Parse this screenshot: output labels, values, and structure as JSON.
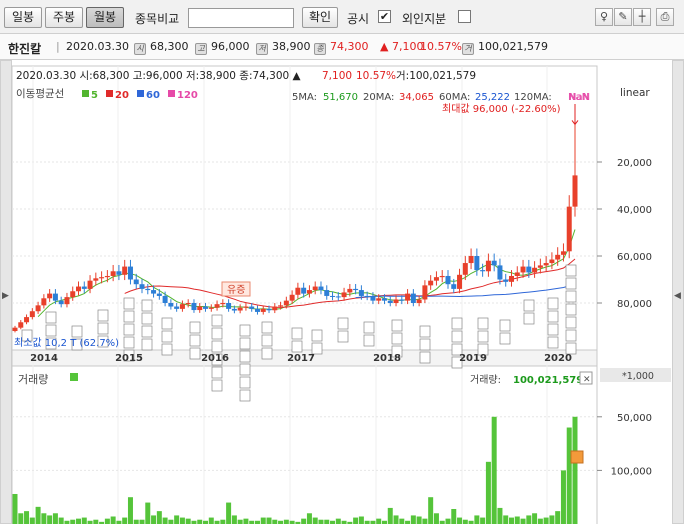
{
  "toolbar": {
    "daily": "일봉",
    "weekly": "주봉",
    "monthly": "월봉",
    "compare_label": "종목비교",
    "confirm": "확인",
    "disclosure_label": "공시",
    "foreign_label": "외인지분",
    "disclosure_checked": "✔",
    "icons": [
      "lamp-icon",
      "pen-icon",
      "crosshair-icon",
      "print-icon"
    ]
  },
  "info": {
    "name": "한진칼",
    "date": "2020.03.30",
    "open_icon": "시",
    "open": "68,300",
    "high_icon": "고",
    "high": "96,000",
    "low_icon": "저",
    "low": "38,900",
    "close_icon": "종",
    "close": "74,300",
    "change": "▲ 7,100",
    "change_pct": "10.57%",
    "volume_icon": "거",
    "volume": "100,021,579"
  },
  "price": {
    "header": "2020.03.30 시:68,300 고:96,000 저:38,900 종:74,300 ▲",
    "header_change": "7,100",
    "header_pct": "10.57%",
    "header_vol": "거:100,021,579",
    "ma_title": "이동평균선",
    "ma_legend": [
      {
        "label": "5",
        "color": "#52b52f"
      },
      {
        "label": "20",
        "color": "#e02a2a"
      },
      {
        "label": "60",
        "color": "#2f67d8"
      },
      {
        "label": "120",
        "color": "#e64aa8"
      }
    ],
    "ma_values": {
      "ma5_label": "5MA:",
      "ma5": "51,670",
      "ma20_label": "20MA:",
      "ma20": "34,065",
      "ma60_label": "60MA:",
      "ma60": "25,222",
      "ma120_label": "120MA:",
      "ma120": "NaN"
    },
    "nan_flag": "NaN",
    "max_label": "최대값 96,000 (-22.60%)",
    "min_label": "최소값 10,2 T (62.7%)",
    "scale": "linear",
    "rights_issue": "유증",
    "y_ticks": [
      "80,000",
      "60,000",
      "40,000",
      "20,000"
    ],
    "x_years": [
      "2014",
      "2015",
      "2016",
      "2017",
      "2018",
      "2019",
      "2020"
    ]
  },
  "volume": {
    "title": "거래량",
    "current_label": "거래량:",
    "current": "100,021,579",
    "multiplier": "*1,000",
    "close_x": "✕",
    "y_ticks": [
      "100,000",
      "50,000"
    ]
  },
  "colors": {
    "up": "#e8402b",
    "down": "#2d7fd6",
    "vol": "#55c43a",
    "ma5": "#52b52f",
    "ma20": "#e02a2a",
    "ma60": "#2f67d8",
    "ma120": "#e64aa8",
    "marker_hi": "#f39a3a"
  },
  "chart_data": [
    {
      "type": "candlestick",
      "title": "",
      "scale": "linear",
      "x_label_years": [
        "2014",
        "2015",
        "2016",
        "2017",
        "2018",
        "2019",
        "2020"
      ],
      "ylim": [
        0,
        100000
      ],
      "y_ticks": [
        20000,
        40000,
        60000,
        80000
      ],
      "annotations": {
        "max": 96000,
        "last_close": 74300
      },
      "ma_last": {
        "ma5": 51670,
        "ma20": 34065,
        "ma60": 25222,
        "ma120": null
      },
      "monthly_closes_estimated": [
        9500,
        11800,
        14000,
        16500,
        19000,
        22000,
        24000,
        21000,
        19500,
        22500,
        25000,
        27000,
        26000,
        29500,
        30500,
        31000,
        31500,
        33500,
        32000,
        35500,
        30000,
        28000,
        26000,
        25500,
        24000,
        23000,
        20000,
        18500,
        17500,
        19500,
        20000,
        17000,
        18500,
        17500,
        18000,
        19500,
        20000,
        17500,
        16800,
        18000,
        18500,
        17500,
        16200,
        17500,
        16900,
        18500,
        19000,
        21000,
        23500,
        26500,
        24000,
        25500,
        27000,
        25500,
        23000,
        22800,
        22500,
        24500,
        26000,
        25500,
        23000,
        22800,
        21000,
        22000,
        21000,
        20000,
        21500,
        21000,
        24000,
        20000,
        21500,
        27500,
        29500,
        31000,
        31500,
        28000,
        26000,
        32000,
        37000,
        40000,
        34000,
        33500,
        38000,
        36000,
        30000,
        29000,
        31500,
        33000,
        35500,
        33000,
        35000,
        36000,
        37000,
        38500,
        40500,
        42000,
        61000,
        74300
      ]
    },
    {
      "type": "bar",
      "title": "거래량",
      "unit": "*1,000",
      "ylim": [
        0,
        125000
      ],
      "y_ticks": [
        50000,
        100000
      ],
      "last_value": 100021579,
      "values_thousands_estimated": [
        28000,
        10000,
        12000,
        6000,
        16000,
        10000,
        8000,
        10000,
        6000,
        3000,
        4000,
        5000,
        6000,
        3000,
        4000,
        2000,
        5000,
        7000,
        3000,
        6000,
        25000,
        4000,
        4000,
        20000,
        8000,
        12000,
        6000,
        4000,
        8000,
        6000,
        5000,
        3000,
        4000,
        3000,
        6000,
        3000,
        4000,
        20000,
        8000,
        4000,
        5000,
        3000,
        3000,
        6000,
        6000,
        4000,
        3000,
        4000,
        3000,
        2000,
        5000,
        10000,
        6000,
        4000,
        4000,
        3000,
        5000,
        3000,
        2000,
        6000,
        7000,
        3000,
        3000,
        5000,
        3000,
        15000,
        8000,
        5000,
        3000,
        8000,
        7000,
        5000,
        25000,
        10000,
        3000,
        5000,
        14000,
        6000,
        4000,
        3000,
        8000,
        6000,
        58000,
        100000,
        15000,
        8000,
        6000,
        7000,
        5000,
        8000,
        10000,
        5000,
        6000,
        8000,
        12000,
        50000,
        90000,
        100000
      ]
    }
  ]
}
